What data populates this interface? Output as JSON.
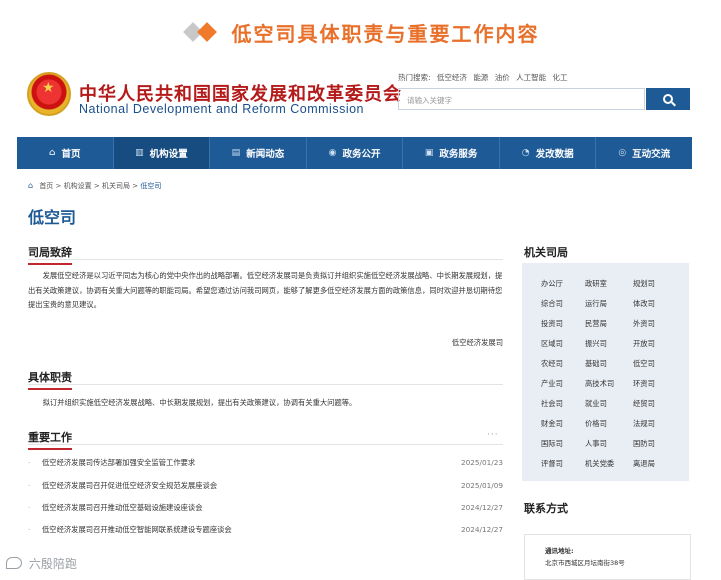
{
  "slide": {
    "title": "低空司具体职责与重要工作内容"
  },
  "header": {
    "org_cn": "中华人民共和国国家发展和改革委员会",
    "org_en": "National Development and Reform Commission",
    "hot_label": "热门搜索:",
    "hot_terms": [
      "低空经济",
      "能源",
      "油价",
      "人工智能",
      "化工"
    ],
    "search_placeholder": "请输入关键字"
  },
  "nav": {
    "items": [
      {
        "label": "首页",
        "icon": "home-icon"
      },
      {
        "label": "机构设置",
        "icon": "building-icon"
      },
      {
        "label": "新闻动态",
        "icon": "news-icon"
      },
      {
        "label": "政务公开",
        "icon": "broadcast-icon"
      },
      {
        "label": "政务服务",
        "icon": "document-icon"
      },
      {
        "label": "发改数据",
        "icon": "pie-chart-icon"
      },
      {
        "label": "互动交流",
        "icon": "chat-icon"
      }
    ],
    "active_index": 1
  },
  "breadcrumb": {
    "items": [
      "首页",
      "机构设置",
      "机关司局"
    ],
    "current": "低空司",
    "separator": ">"
  },
  "page": {
    "title": "低空司"
  },
  "intro": {
    "title": "司局致辞",
    "text": "发展低空经济是以习近平同志为核心的党中央作出的战略部署。低空经济发展司是负责拟订并组织实施低空经济发展战略、中长期发展规划，提出有关政策建议，协调有关重大问题等的职能司局。希望您通过访问我司网页，能够了解更多低空经济发展方面的政策信息，同时欢迎并恳切期待您提出宝贵的意见建议。",
    "signature": "低空经济发展司"
  },
  "duties": {
    "title": "具体职责",
    "text": "拟订并组织实施低空经济发展战略、中长期发展规划，提出有关政策建议，协调有关重大问题等。"
  },
  "work": {
    "title": "重要工作",
    "more": "···",
    "items": [
      {
        "title": "低空经济发展司传达部署加强安全监管工作要求",
        "date": "2025/01/23"
      },
      {
        "title": "低空经济发展司召开促进低空经济安全规范发展座谈会",
        "date": "2025/01/09"
      },
      {
        "title": "低空经济发展司召开推动低空基础设施建设座谈会",
        "date": "2024/12/27"
      },
      {
        "title": "低空经济发展司召开推动低空智能网联系统建设专题座谈会",
        "date": "2024/12/27"
      }
    ]
  },
  "departments": {
    "title": "机关司局",
    "rows": [
      [
        "办公厅",
        "政研室",
        "规划司"
      ],
      [
        "综合司",
        "运行局",
        "体改司"
      ],
      [
        "投资司",
        "民营局",
        "外资司"
      ],
      [
        "区域司",
        "振兴司",
        "开放司"
      ],
      [
        "农经司",
        "基础司",
        "低空司"
      ],
      [
        "产业司",
        "高技术司",
        "环资司"
      ],
      [
        "社会司",
        "就业司",
        "经贸司"
      ],
      [
        "财金司",
        "价格司",
        "法规司"
      ],
      [
        "国际司",
        "人事司",
        "国防司"
      ],
      [
        "评督司",
        "机关党委",
        "离退局"
      ]
    ]
  },
  "contact": {
    "title": "联系方式",
    "label": "通讯地址:",
    "address": "北京市西城区月坛南街38号"
  },
  "watermark": {
    "text": "六殷陪跑"
  },
  "colors": {
    "brand_blue": "#1e5a96",
    "accent_red": "#c0282d",
    "title_orange": "#e8702a"
  }
}
